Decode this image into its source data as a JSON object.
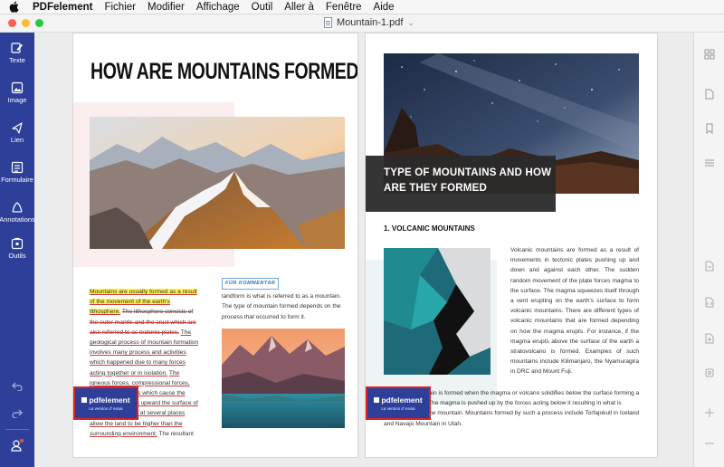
{
  "menubar": {
    "app_name": "PDFelement",
    "items": [
      "Fichier",
      "Modifier",
      "Affichage",
      "Outil",
      "Aller à",
      "Fenêtre",
      "Aide"
    ]
  },
  "window": {
    "title": "Mountain-1.pdf"
  },
  "left_sidebar": {
    "tools": [
      {
        "label": "Texte",
        "icon": "text-edit-icon"
      },
      {
        "label": "Image",
        "icon": "image-icon"
      },
      {
        "label": "Lien",
        "icon": "link-icon"
      },
      {
        "label": "Formulaire",
        "icon": "form-icon"
      },
      {
        "label": "Annotations",
        "icon": "annotation-icon"
      },
      {
        "label": "Outils",
        "icon": "tools-icon"
      }
    ],
    "bottom": [
      "undo-icon",
      "redo-icon",
      "account-icon"
    ]
  },
  "page_left": {
    "heading": "HOW ARE MOUNTAINS FORMED?",
    "col1": {
      "hl": "Mountains are usually formed as a result of the movement of the earth's lithosphere.",
      "strike": "The lithosphere consists of the outer mantle and the crust which are also referred to as tectonic plates.",
      "under1": "The geological process of mountain formation involves many process and activities which happened due to many forces acting together or in isolation.",
      "under2": "The igneous forces, compressional forces, and isostatic forces which cause the earth crust to push upward the surface of the earth's surface at several places allow the land to be higher than the surrounding environment.",
      "tail": "The resultant"
    },
    "annotation_label": "FÜR KOMMENTAR",
    "col2": "landform is what is referred to as a mountain. The type of mountain formed depends on the process that occurred to form it."
  },
  "page_right": {
    "heading": "TYPE OF MOUNTAINS AND HOW ARE THEY FORMED",
    "subheading": "1. VOLCANIC MOUNTAINS",
    "para1": "Volcanic mountains are formed as a result of movements in tectonic plates pushing up and down and against each other. The sudden random movement of the plate forces magma to the surface. The magma squeezes itself through a vent erupting on the earth's surface to form volcanic mountains. There are different types of volcanic mountains that are formed depending on how the magma erupts. For instance, if the magma erupts above the surface of the earth a stratovolcano is formed. Examples of such mountains include Kilimanjaro, the Nyamuragira in DRC and Mount Fuji.",
    "para2": "A volcanic mountain is formed when the magma or volcano solidifies below the surface forming a dome mountain. The magma is pushed up by the forces acting below it resulting in what is referred to as dome mountain. Mountains formed by such a process include Torfajokull in Iceland and Navajo Mountain in Utah."
  },
  "watermark": {
    "logo": "pdfelement",
    "sub": "La version d' essai"
  },
  "colors": {
    "sidebar": "#2e3f9a",
    "watermark_border": "#dd2222",
    "highlight": "#fff34a"
  }
}
